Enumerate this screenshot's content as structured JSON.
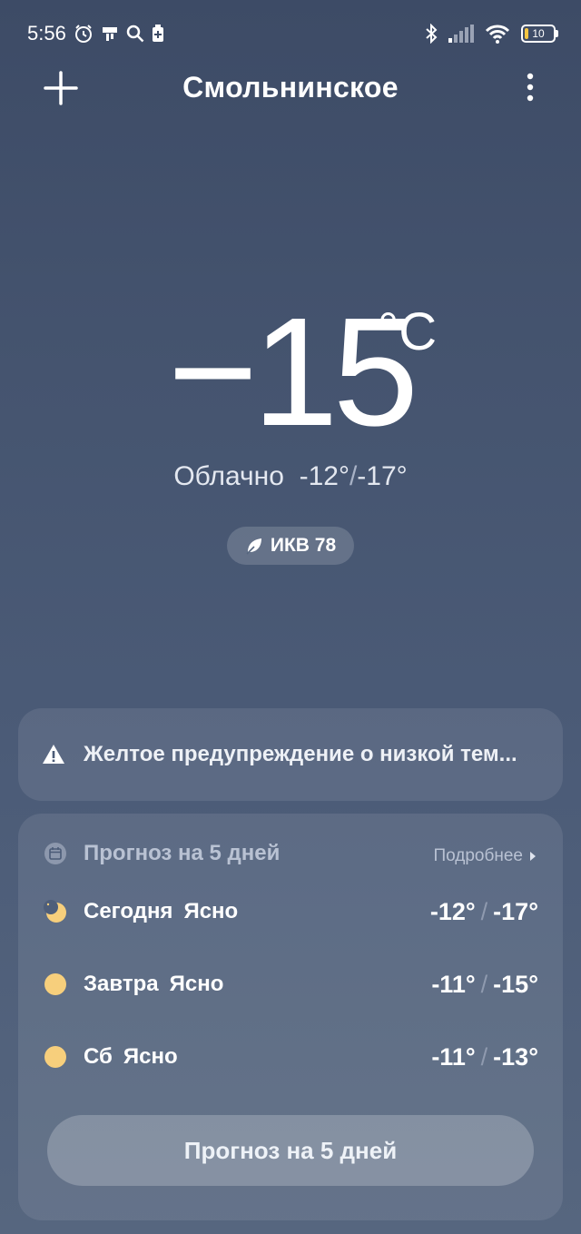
{
  "status_bar": {
    "time": "5:56",
    "battery": "10"
  },
  "header": {
    "city": "Смольнинское"
  },
  "current": {
    "temperature": "−15",
    "unit": "°C",
    "condition": "Облачно",
    "high": "-12°",
    "low": "-17°",
    "aqi_label": "ИКВ 78"
  },
  "alert": {
    "text": "Желтое предупреждение о низкой тем..."
  },
  "forecast": {
    "title": "Прогноз на 5 дней",
    "more": "Подробнее",
    "days": [
      {
        "day": "Сегодня",
        "condition": "Ясно",
        "high": "-12°",
        "low": "-17°",
        "icon": "moon-icon"
      },
      {
        "day": "Завтра",
        "condition": "Ясно",
        "high": "-11°",
        "low": "-15°",
        "icon": "sun-icon"
      },
      {
        "day": "Сб",
        "condition": "Ясно",
        "high": "-11°",
        "low": "-13°",
        "icon": "sun-icon"
      }
    ],
    "button": "Прогноз на 5 дней"
  },
  "colors": {
    "sun": "#f7cf7c",
    "accent_battery": "#f4c542"
  }
}
